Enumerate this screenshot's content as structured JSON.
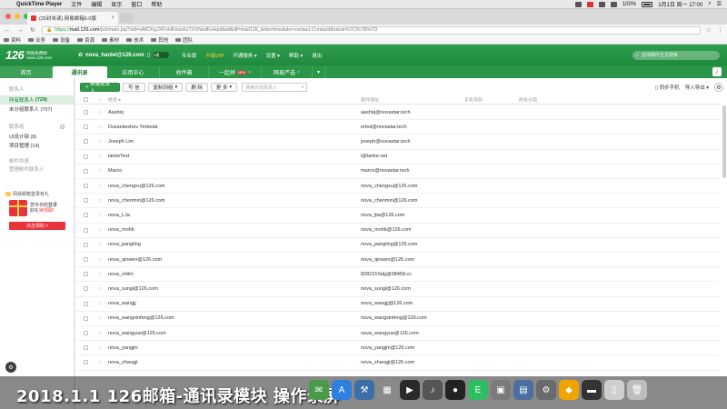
{
  "menubar": {
    "app": "QuickTime Player",
    "items": [
      "文件",
      "编辑",
      "显示",
      "窗口",
      "帮助"
    ],
    "battery": "100%",
    "clock": "1月1日 周一 17:00"
  },
  "browser": {
    "tab_title": "(25封未读) 网易邮箱6.0版",
    "url_scheme": "https://",
    "url_host": "mail.126.com",
    "url_rest": "/js6/main.jsp?sid=xAfCKgJXFoHKlowXuTXXNxdKeHpdbwf&df=mail126_letter#module=contact.ContactModule%7C%7B%7D",
    "bookmarks": [
      "资料",
      "业务",
      "设备",
      "资源",
      "素材",
      "技术",
      "其他",
      "团队"
    ]
  },
  "mail_header": {
    "logo_number": "126",
    "logo_line1": "网易免费邮",
    "logo_line2": "www.126.com",
    "account": "nova_hanlei@126.com",
    "toggle_label": "0通",
    "links": [
      "专业版",
      "升级VIP",
      "开通服务",
      "设置",
      "帮助",
      "退出"
    ],
    "search_placeholder": "支持邮件全文搜索"
  },
  "nav": {
    "tabs": [
      {
        "label": "首页"
      },
      {
        "label": "通讯录"
      },
      {
        "label": "应用中心"
      },
      {
        "label": "收件箱"
      },
      {
        "label": "一起拼",
        "badge": "NEW"
      },
      {
        "label": "网易严选"
      }
    ]
  },
  "sidebar": {
    "section_contacts": "联系人",
    "all_contacts": "所有联系人",
    "all_count": "(729)",
    "ungrouped": "未分组联系人 (707)",
    "section_groups": "联系组",
    "group1": "UI设计部 (8)",
    "group2": "项目管理 (14)",
    "section_archive": "邮件列表",
    "archive_item": "管理邮件联系人",
    "ad_title": "网易邮箱登录有礼",
    "ad_line1": "您今日的登录",
    "ad_line2_a": "好礼",
    "ad_line2_b": "待领取!",
    "ad_button": "点击领取 >"
  },
  "toolbar": {
    "new_contact": "新建联系人",
    "write_mail": "写 信",
    "copy_to": "复制到组",
    "delete": "删 除",
    "more": "更 多",
    "search_placeholder": "搜索所有联系人",
    "sync_phone": "同步手机",
    "import_export": "导入导出"
  },
  "table": {
    "headers": {
      "name": "姓名",
      "email": "邮件地址",
      "phone": "手机号码",
      "group": "所在分组"
    },
    "rows": [
      {
        "name": "Aashiq",
        "email": "aashiq@novastar.tech"
      },
      {
        "name": "Dusseke­shev Yerbolat",
        "email": "erbol@novastar.tech"
      },
      {
        "name": "Joseph Lim",
        "email": "joseph@novastar.tech"
      },
      {
        "name": "lankeTest",
        "email": "i@lanke.net"
      },
      {
        "name": "Marco",
        "email": "marco@novastar.tech"
      },
      {
        "name": "nova_chengxu@126.com",
        "email": "nova_chengxu@126.com"
      },
      {
        "name": "nova_chenmin@126.com",
        "email": "nova_chenmin@126.com"
      },
      {
        "name": "nova_LJa",
        "email": "nova_ljia@126.com"
      },
      {
        "name": "nova_mohb",
        "email": "nova_mohb@126.com"
      },
      {
        "name": "nova_pangling",
        "email": "nova_pangling@126.com"
      },
      {
        "name": "nova_qinwen@126.com",
        "email": "nova_qinwen@126.com"
      },
      {
        "name": "nova_shilm",
        "email": "828215Sdg@08458.cc"
      },
      {
        "name": "nova_sungl@126.com",
        "email": "nova_sungl@126.com"
      },
      {
        "name": "nova_wangjj",
        "email": "nova_wangjj@126.com"
      },
      {
        "name": "nova_wangxinfeng@126.com",
        "email": "nova_wangxinfeng@126.com"
      },
      {
        "name": "nova_wangyue@126.com",
        "email": "nova_wangyue@126.com"
      },
      {
        "name": "nova_yangjm",
        "email": "nova_yangjm@126.com"
      },
      {
        "name": "nova_zhangji",
        "email": "nova_zhangji@126.com"
      }
    ]
  },
  "caption": "2018.1.1 126邮箱-通讯录模块 操作录屏",
  "dock": {
    "icons": [
      {
        "name": "messages-icon",
        "color": "#4a9a4a",
        "glyph": "✉"
      },
      {
        "name": "app-store-icon",
        "color": "#2d7fe0",
        "glyph": "A"
      },
      {
        "name": "xcode-icon",
        "color": "#3c6ea8",
        "glyph": "⚒"
      },
      {
        "name": "photos-icon",
        "color": "#8a8a8a",
        "glyph": "▦"
      },
      {
        "name": "quicktime-icon",
        "color": "#2a2a2a",
        "glyph": "▶"
      },
      {
        "name": "music-icon",
        "color": "#555",
        "glyph": "♪"
      },
      {
        "name": "qq-icon",
        "color": "#222",
        "glyph": "●"
      },
      {
        "name": "evernote-icon",
        "color": "#2dbe60",
        "glyph": "E"
      },
      {
        "name": "preview-icon",
        "color": "#7a7a7a",
        "glyph": "▣"
      },
      {
        "name": "keynote-icon",
        "color": "#4a6fa0",
        "glyph": "▤"
      },
      {
        "name": "system-prefs-icon",
        "color": "#6a6a6a",
        "glyph": "⚙"
      },
      {
        "name": "sketch-icon",
        "color": "#f1a400",
        "glyph": "◆"
      },
      {
        "name": "terminal-icon",
        "color": "#333",
        "glyph": "▬"
      },
      {
        "name": "documents-icon",
        "color": "#cfcfcf",
        "glyph": "▯"
      },
      {
        "name": "trash-icon",
        "color": "#bdbdbd",
        "glyph": "🗑"
      }
    ]
  }
}
